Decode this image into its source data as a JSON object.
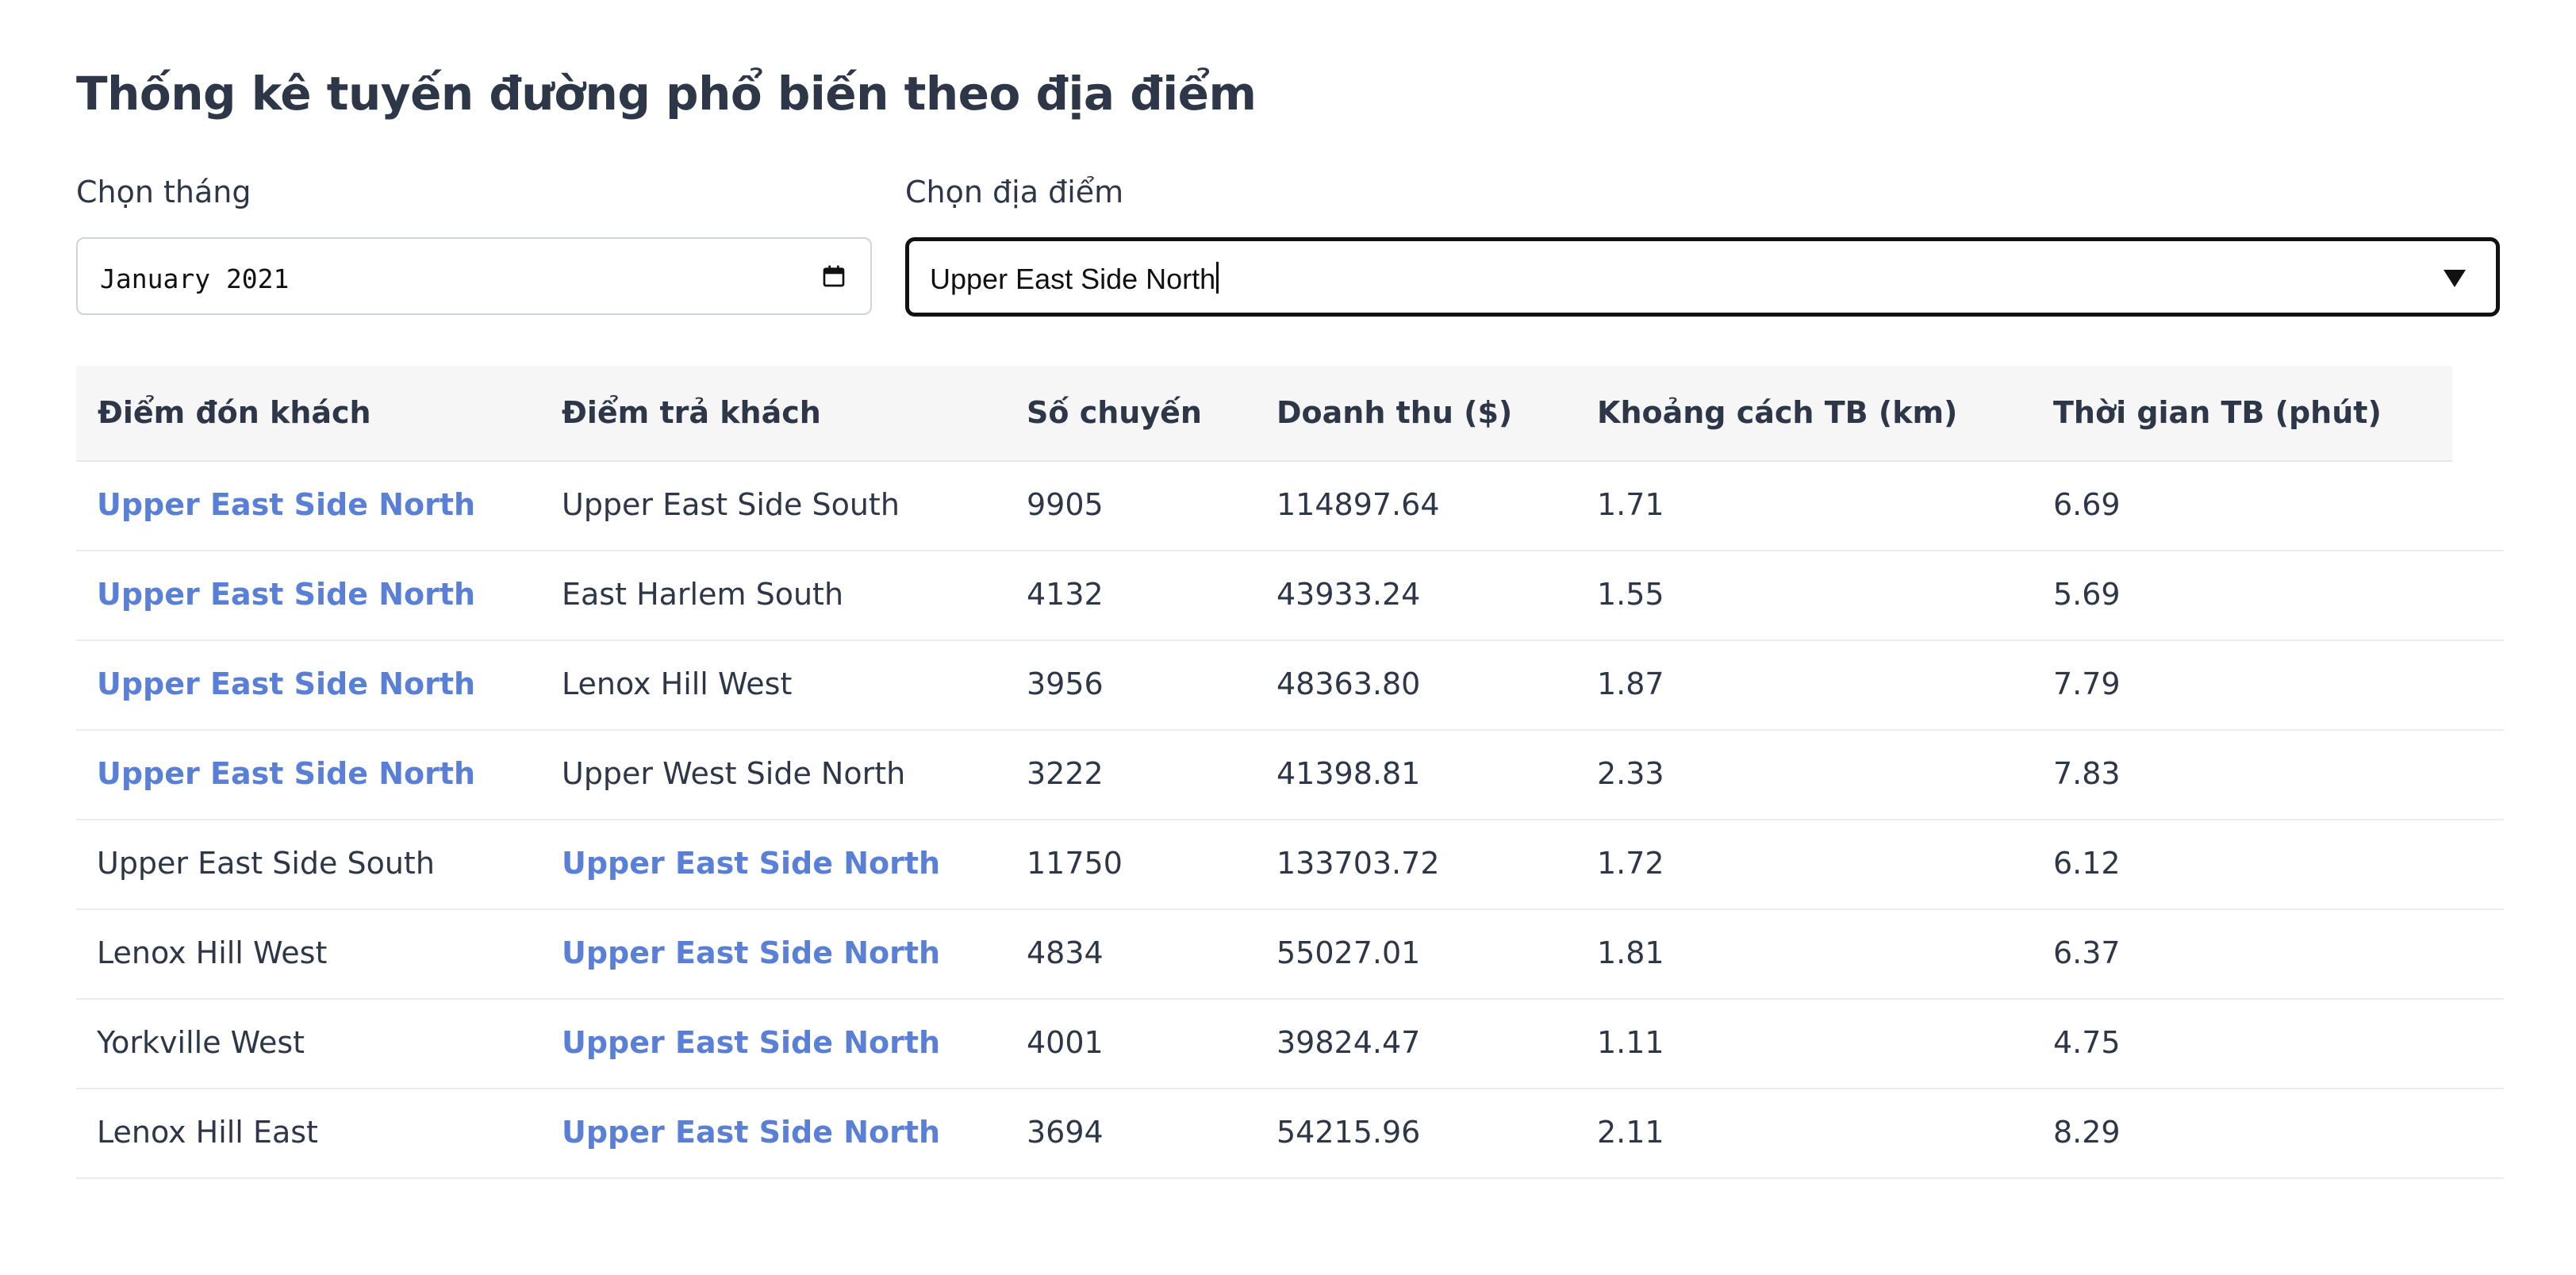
{
  "page": {
    "title": "Thống kê tuyến đường phổ biến theo địa điểm"
  },
  "filters": {
    "month_label": "Chọn tháng",
    "month_value": "January 2021",
    "location_label": "Chọn địa điểm",
    "location_value": "Upper East Side North"
  },
  "table": {
    "headers": [
      "Điểm đón khách",
      "Điểm trả khách",
      "Số chuyến",
      "Doanh thu ($)",
      "Khoảng cách TB (km)",
      "Thời gian TB (phút)"
    ],
    "rows": [
      {
        "pickup": "Upper East Side North",
        "dropoff": "Upper East Side South",
        "trips": "9905",
        "revenue": "114897.64",
        "distance": "1.71",
        "duration": "6.69"
      },
      {
        "pickup": "Upper East Side North",
        "dropoff": "East Harlem South",
        "trips": "4132",
        "revenue": "43933.24",
        "distance": "1.55",
        "duration": "5.69"
      },
      {
        "pickup": "Upper East Side North",
        "dropoff": "Lenox Hill West",
        "trips": "3956",
        "revenue": "48363.80",
        "distance": "1.87",
        "duration": "7.79"
      },
      {
        "pickup": "Upper East Side North",
        "dropoff": "Upper West Side North",
        "trips": "3222",
        "revenue": "41398.81",
        "distance": "2.33",
        "duration": "7.83"
      },
      {
        "pickup": "Upper East Side South",
        "dropoff": "Upper East Side North",
        "trips": "11750",
        "revenue": "133703.72",
        "distance": "1.72",
        "duration": "6.12"
      },
      {
        "pickup": "Lenox Hill West",
        "dropoff": "Upper East Side North",
        "trips": "4834",
        "revenue": "55027.01",
        "distance": "1.81",
        "duration": "6.37"
      },
      {
        "pickup": "Yorkville West",
        "dropoff": "Upper East Side North",
        "trips": "4001",
        "revenue": "39824.47",
        "distance": "1.11",
        "duration": "4.75"
      },
      {
        "pickup": "Lenox Hill East",
        "dropoff": "Upper East Side North",
        "trips": "3694",
        "revenue": "54215.96",
        "distance": "2.11",
        "duration": "8.29"
      }
    ]
  },
  "colors": {
    "highlight": "#5a7fd6",
    "text": "#2d3748",
    "header_bg": "#f6f6f6"
  }
}
